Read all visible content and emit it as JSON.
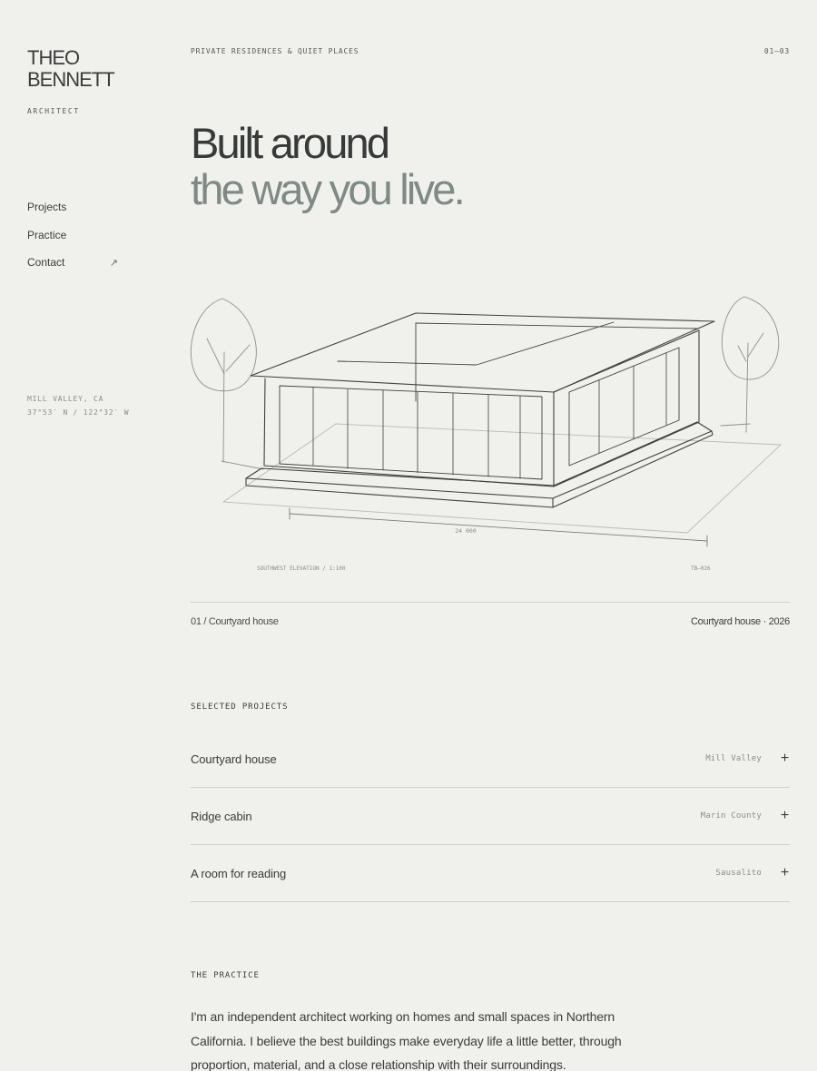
{
  "brand": {
    "name_line1": "THEO",
    "name_line2": "BENNETT",
    "role": "ARCHITECT"
  },
  "nav": {
    "items": [
      {
        "label": "Projects"
      },
      {
        "label": "Practice"
      },
      {
        "label": "Contact",
        "icon": "arrow-up-right-icon",
        "glyph": "↗"
      }
    ]
  },
  "location": {
    "city": "MILL VALLEY, CA",
    "coords": "37°53′ N / 122°32′ W"
  },
  "header": {
    "eyebrow": "PRIVATE RESIDENCES & QUIET PLACES",
    "pager": "01—03"
  },
  "hero": {
    "line1": "Built around",
    "line2": "the way you live."
  },
  "drawing": {
    "dimension_label": "24 000",
    "elevation_label": "SOUTHWEST ELEVATION / 1:100",
    "sheet_code": "TB—026"
  },
  "caption": {
    "left": "01 / Courtyard house",
    "right": "Courtyard house · 2026"
  },
  "projects_section": {
    "label": "SELECTED PROJECTS",
    "items": [
      {
        "name": "Courtyard house",
        "place": "Mill Valley"
      },
      {
        "name": "Ridge cabin",
        "place": "Marin County"
      },
      {
        "name": "A room for reading",
        "place": "Sausalito"
      }
    ],
    "expand_glyph": "+"
  },
  "practice_section": {
    "label": "THE PRACTICE",
    "body": "I'm an independent architect working on homes and small spaces in Northern California. I believe the best buildings make everyday life a little better, through proportion, material, and a close relationship with their surroundings."
  },
  "colors": {
    "background": "#f0f0ec",
    "ink": "#3a3d3c",
    "hero_accent": "#7f8a86",
    "muted": "#8a8e8c",
    "rule": "#cfd0cc"
  }
}
